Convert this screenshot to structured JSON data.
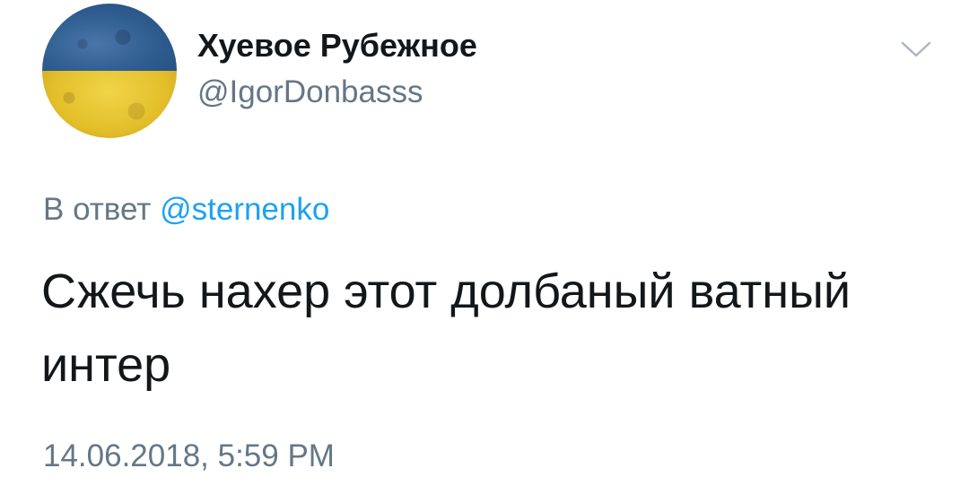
{
  "tweet": {
    "author": {
      "display_name": "Хуевое Рубежное",
      "handle": "@IgorDonbasss",
      "avatar_icon": "ukraine-flag-avatar"
    },
    "menu_icon": "chevron-down-icon",
    "reply_prefix": "В ответ",
    "reply_to": "@sternenko",
    "text": "Сжечь нахер этот долбаный ватный интер",
    "timestamp": "14.06.2018, 5:59 PM"
  },
  "colors": {
    "text_primary": "#14171a",
    "text_secondary": "#657786",
    "link": "#1da1f2",
    "flag_blue": "#2e5c8f",
    "flag_yellow": "#e3be2a"
  }
}
